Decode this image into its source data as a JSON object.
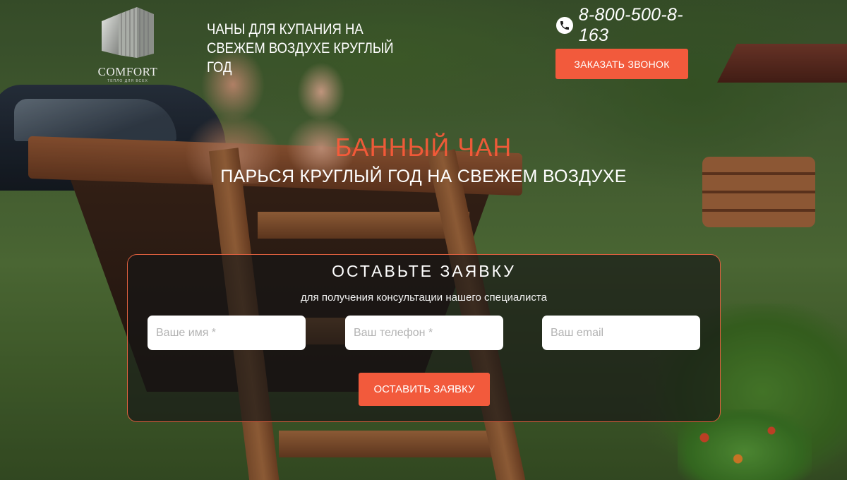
{
  "header": {
    "logo": {
      "wordmark": "COMFORT",
      "subline": "ТЕПЛО ДЛЯ ВСЕХ"
    },
    "tagline": "ЧАНЫ ДЛЯ КУПАНИЯ НА СВЕЖЕМ ВОЗДУХЕ КРУГЛЫЙ ГОД",
    "phone": {
      "icon": "phone-icon",
      "number": "8-800-500-8-163"
    },
    "callback_button": "ЗАКАЗАТЬ ЗВОНОК"
  },
  "hero": {
    "title": "БАННЫЙ ЧАН",
    "subtitle": "ПАРЬСЯ КРУГЛЫЙ ГОД НА СВЕЖЕМ ВОЗДУХЕ"
  },
  "form": {
    "title": "ОСТАВЬТЕ ЗАЯВКУ",
    "subtitle": "для получения консультации нашего специалиста",
    "fields": {
      "name": {
        "value": "",
        "placeholder": "Ваше имя *"
      },
      "phone": {
        "value": "",
        "placeholder": "Ваш телефон *"
      },
      "email": {
        "value": "",
        "placeholder": "Ваш email"
      }
    },
    "submit_button": "ОСТАВИТЬ ЗАЯВКУ"
  },
  "colors": {
    "accent": "#f25a3c",
    "title_accent": "#ff5b3a",
    "panel_border": "#e0603f"
  }
}
